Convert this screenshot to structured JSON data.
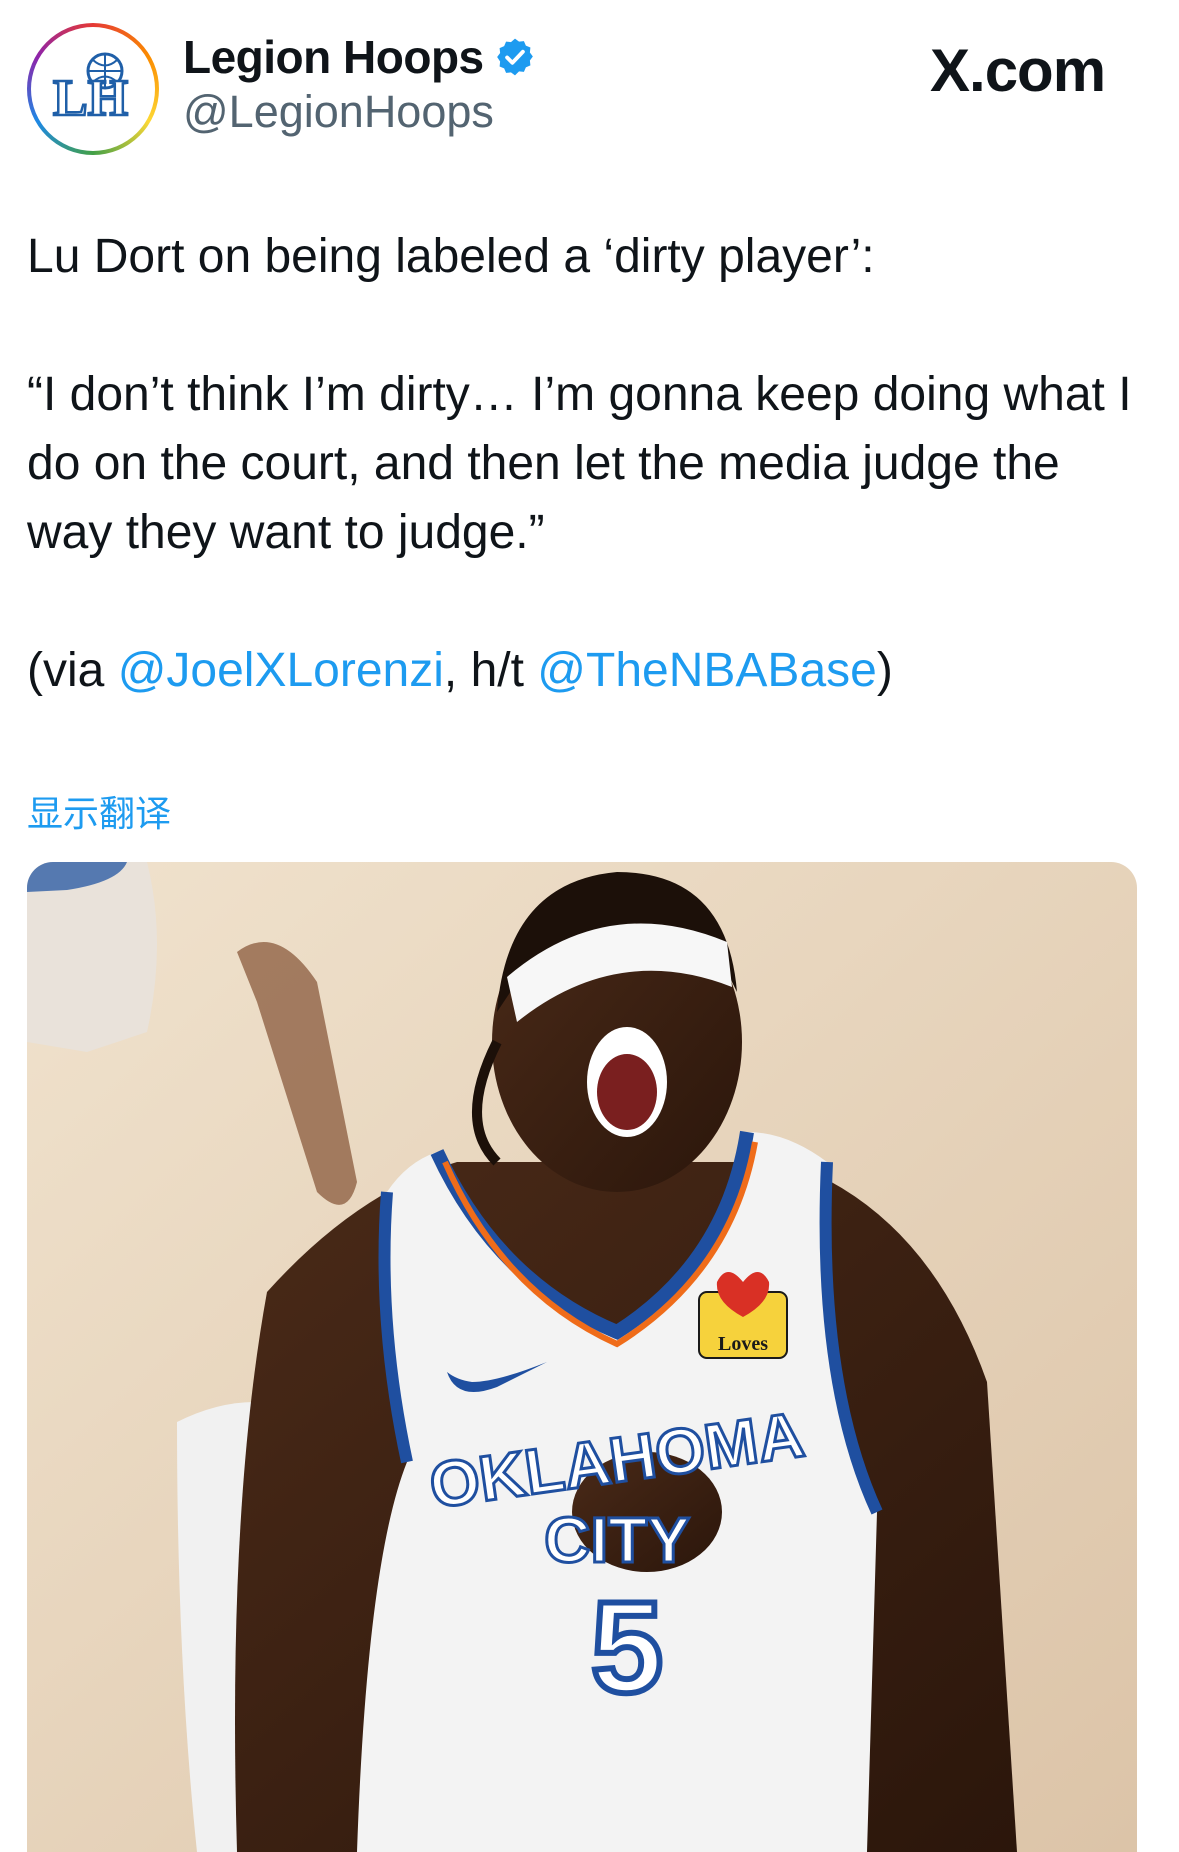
{
  "header": {
    "avatar_monogram": "LH",
    "display_name": "Legion Hoops",
    "handle": "@LegionHoops",
    "brand": "X.com"
  },
  "tweet": {
    "line1": "Lu Dort on being labeled a ‘dirty player’:",
    "quote": "“I don’t think I’m dirty… I’m gonna keep doing what I do on the court, and then let the media judge the way they want to judge.”",
    "via_prefix": "(via ",
    "mention1": "@JoelXLorenzi",
    "ht_text": ", h/t ",
    "mention2": "@TheNBABase",
    "via_suffix": ")"
  },
  "translate_label": "显示翻译",
  "media": {
    "jersey_text_line1": "OKLAHOMA",
    "jersey_text_line2": "CITY",
    "jersey_number": "5",
    "sponsor_patch": "Loves"
  },
  "colors": {
    "accent": "#1d9bf0",
    "secondary_text": "#536471",
    "verified_badge": "#1d9bf0",
    "jersey_blue": "#1f4fa0",
    "jersey_orange": "#ef6c1a"
  },
  "icons": {
    "verified": "verified-badge-icon",
    "x_logo": "x-logo-icon",
    "nike": "nike-swoosh-icon"
  }
}
